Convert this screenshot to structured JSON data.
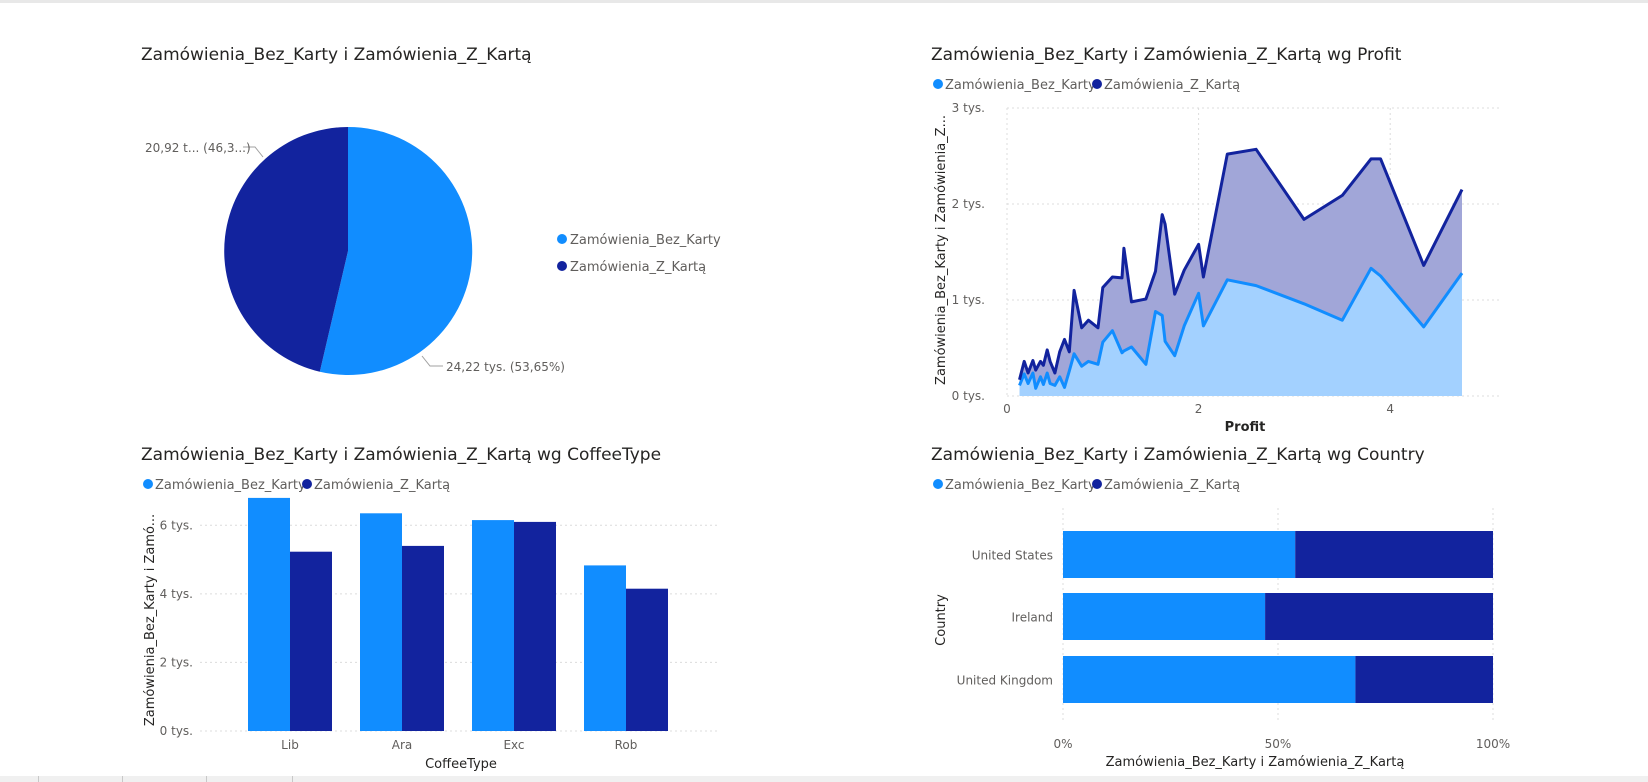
{
  "colors": {
    "bez": "#118DFF",
    "z": "#12239E",
    "bez_area": "#a3d1ff",
    "z_area": "#a1a6d8"
  },
  "chart_data": [
    {
      "type": "pie",
      "title": "Zamówienia_Bez_Karty i Zamówienia_Z_Kartą",
      "legend_position": "right",
      "labels": [
        "Zamówienia_Bez_Karty",
        "Zamówienia_Z_Kartą"
      ],
      "values": [
        24.22,
        20.92
      ],
      "data_labels": [
        "24,22 tys. (53,65%)",
        "20,92 t... (46,3...)"
      ]
    },
    {
      "type": "area",
      "title": "Zamówienia_Bez_Karty i Zamówienia_Z_Kartą wg Profit",
      "legend_position": "top-left",
      "xlabel": "Profit",
      "ylabel": "Zamówienia_Bez_Karty i Zamówienia_Z...",
      "x_ticks": [
        "0",
        "2",
        "4"
      ],
      "xlim": [
        0,
        5
      ],
      "y_ticks": [
        "0 tys.",
        "1 tys.",
        "2 tys.",
        "3 tys."
      ],
      "ylim": [
        0,
        3000
      ],
      "grid": true,
      "x": [
        0.13,
        0.18,
        0.22,
        0.27,
        0.3,
        0.35,
        0.38,
        0.42,
        0.45,
        0.5,
        0.55,
        0.6,
        0.65,
        0.7,
        0.78,
        0.85,
        0.95,
        1.0,
        1.1,
        1.2,
        1.22,
        1.3,
        1.45,
        1.55,
        1.62,
        1.65,
        1.75,
        1.85,
        2.0,
        2.05,
        2.3,
        2.6,
        3.1,
        3.5,
        3.8,
        3.9,
        4.35,
        4.75
      ],
      "series": [
        {
          "name": "Zamówienia_Bez_Karty",
          "values": [
            110,
            230,
            130,
            240,
            80,
            200,
            120,
            240,
            130,
            110,
            200,
            90,
            260,
            440,
            310,
            360,
            330,
            560,
            680,
            450,
            470,
            510,
            330,
            880,
            840,
            570,
            420,
            730,
            1070,
            730,
            1210,
            1150,
            960,
            790,
            1330,
            1250,
            720,
            1280
          ]
        },
        {
          "name": "Zamówienia_Z_Kartą",
          "values": [
            60,
            130,
            110,
            130,
            190,
            160,
            200,
            240,
            230,
            130,
            260,
            500,
            200,
            660,
            400,
            430,
            380,
            570,
            560,
            780,
            1070,
            470,
            680,
            420,
            1050,
            1220,
            640,
            580,
            510,
            510,
            1310,
            1420,
            880,
            1300,
            1140,
            1220,
            640,
            870
          ]
        }
      ]
    },
    {
      "type": "bar",
      "title": "Zamówienia_Bez_Karty i Zamówienia_Z_Kartą wg CoffeeType",
      "legend_position": "top-left",
      "xlabel": "CoffeeType",
      "ylabel": "Zamówienia_Bez_Karty i Zamó...",
      "categories": [
        "Lib",
        "Ara",
        "Exc",
        "Rob"
      ],
      "y_ticks": [
        "0 tys.",
        "2 tys.",
        "4 tys.",
        "6 tys."
      ],
      "ylim": [
        0,
        7000
      ],
      "grid": true,
      "series": [
        {
          "name": "Zamówienia_Bez_Karty",
          "values": [
            6800,
            6350,
            6150,
            4830
          ]
        },
        {
          "name": "Zamówienia_Z_Kartą",
          "values": [
            5230,
            5400,
            6100,
            4150
          ]
        }
      ]
    },
    {
      "type": "bar",
      "orientation": "horizontal",
      "stacked": "100%",
      "title": "Zamówienia_Bez_Karty i Zamówienia_Z_Kartą wg Country",
      "legend_position": "top-left",
      "xlabel": "Zamówienia_Bez_Karty i Zamówienia_Z_Kartą",
      "ylabel": "Country",
      "categories": [
        "United States",
        "Ireland",
        "United Kingdom"
      ],
      "x_ticks": [
        "0%",
        "50%",
        "100%"
      ],
      "xlim": [
        0,
        100
      ],
      "grid": true,
      "series": [
        {
          "name": "Zamówienia_Bez_Karty",
          "values": [
            54,
            47,
            68
          ]
        },
        {
          "name": "Zamówienia_Z_Kartą",
          "values": [
            46,
            53,
            32
          ]
        }
      ]
    }
  ]
}
